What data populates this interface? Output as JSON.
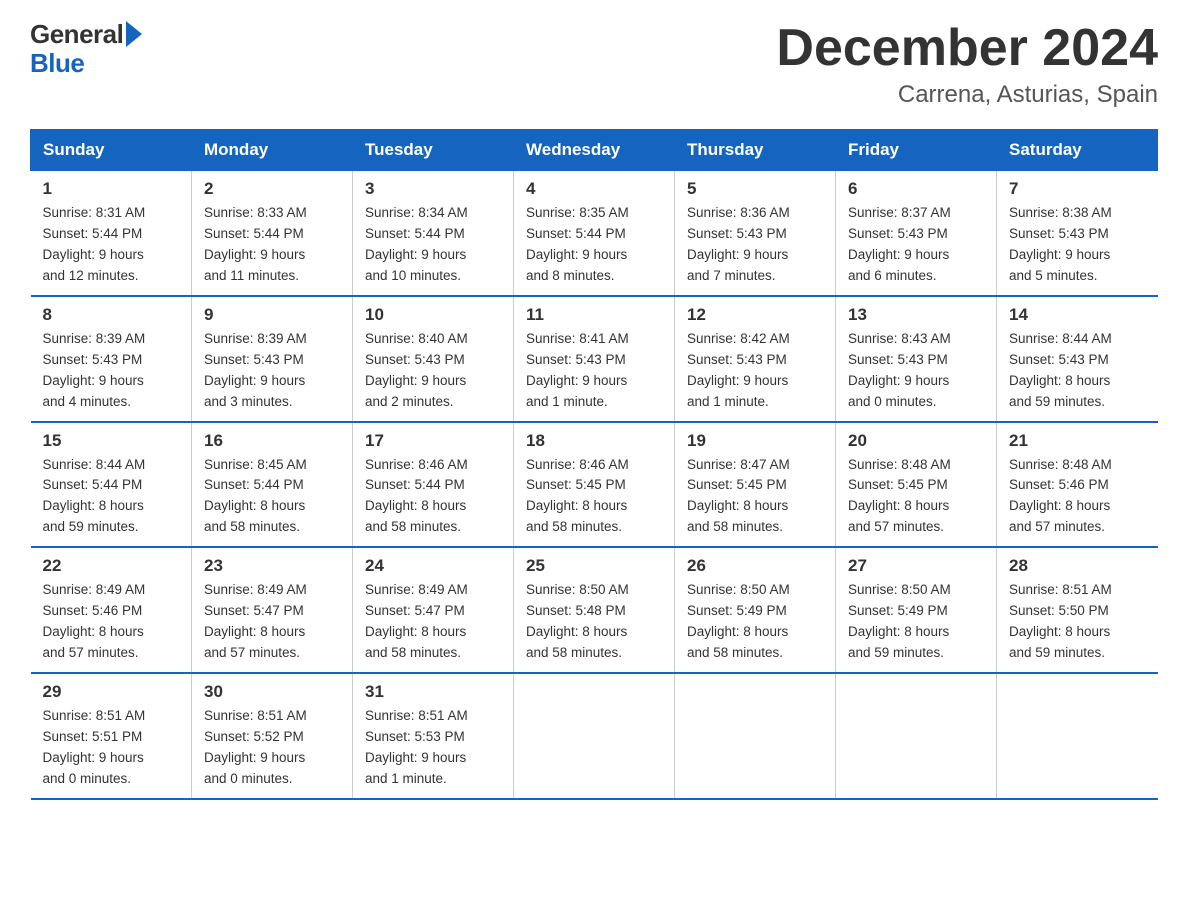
{
  "logo": {
    "line1": "General",
    "line2": "Blue"
  },
  "title": "December 2024",
  "subtitle": "Carrena, Asturias, Spain",
  "days_of_week": [
    "Sunday",
    "Monday",
    "Tuesday",
    "Wednesday",
    "Thursday",
    "Friday",
    "Saturday"
  ],
  "weeks": [
    [
      {
        "day": "1",
        "info": "Sunrise: 8:31 AM\nSunset: 5:44 PM\nDaylight: 9 hours\nand 12 minutes."
      },
      {
        "day": "2",
        "info": "Sunrise: 8:33 AM\nSunset: 5:44 PM\nDaylight: 9 hours\nand 11 minutes."
      },
      {
        "day": "3",
        "info": "Sunrise: 8:34 AM\nSunset: 5:44 PM\nDaylight: 9 hours\nand 10 minutes."
      },
      {
        "day": "4",
        "info": "Sunrise: 8:35 AM\nSunset: 5:44 PM\nDaylight: 9 hours\nand 8 minutes."
      },
      {
        "day": "5",
        "info": "Sunrise: 8:36 AM\nSunset: 5:43 PM\nDaylight: 9 hours\nand 7 minutes."
      },
      {
        "day": "6",
        "info": "Sunrise: 8:37 AM\nSunset: 5:43 PM\nDaylight: 9 hours\nand 6 minutes."
      },
      {
        "day": "7",
        "info": "Sunrise: 8:38 AM\nSunset: 5:43 PM\nDaylight: 9 hours\nand 5 minutes."
      }
    ],
    [
      {
        "day": "8",
        "info": "Sunrise: 8:39 AM\nSunset: 5:43 PM\nDaylight: 9 hours\nand 4 minutes."
      },
      {
        "day": "9",
        "info": "Sunrise: 8:39 AM\nSunset: 5:43 PM\nDaylight: 9 hours\nand 3 minutes."
      },
      {
        "day": "10",
        "info": "Sunrise: 8:40 AM\nSunset: 5:43 PM\nDaylight: 9 hours\nand 2 minutes."
      },
      {
        "day": "11",
        "info": "Sunrise: 8:41 AM\nSunset: 5:43 PM\nDaylight: 9 hours\nand 1 minute."
      },
      {
        "day": "12",
        "info": "Sunrise: 8:42 AM\nSunset: 5:43 PM\nDaylight: 9 hours\nand 1 minute."
      },
      {
        "day": "13",
        "info": "Sunrise: 8:43 AM\nSunset: 5:43 PM\nDaylight: 9 hours\nand 0 minutes."
      },
      {
        "day": "14",
        "info": "Sunrise: 8:44 AM\nSunset: 5:43 PM\nDaylight: 8 hours\nand 59 minutes."
      }
    ],
    [
      {
        "day": "15",
        "info": "Sunrise: 8:44 AM\nSunset: 5:44 PM\nDaylight: 8 hours\nand 59 minutes."
      },
      {
        "day": "16",
        "info": "Sunrise: 8:45 AM\nSunset: 5:44 PM\nDaylight: 8 hours\nand 58 minutes."
      },
      {
        "day": "17",
        "info": "Sunrise: 8:46 AM\nSunset: 5:44 PM\nDaylight: 8 hours\nand 58 minutes."
      },
      {
        "day": "18",
        "info": "Sunrise: 8:46 AM\nSunset: 5:45 PM\nDaylight: 8 hours\nand 58 minutes."
      },
      {
        "day": "19",
        "info": "Sunrise: 8:47 AM\nSunset: 5:45 PM\nDaylight: 8 hours\nand 58 minutes."
      },
      {
        "day": "20",
        "info": "Sunrise: 8:48 AM\nSunset: 5:45 PM\nDaylight: 8 hours\nand 57 minutes."
      },
      {
        "day": "21",
        "info": "Sunrise: 8:48 AM\nSunset: 5:46 PM\nDaylight: 8 hours\nand 57 minutes."
      }
    ],
    [
      {
        "day": "22",
        "info": "Sunrise: 8:49 AM\nSunset: 5:46 PM\nDaylight: 8 hours\nand 57 minutes."
      },
      {
        "day": "23",
        "info": "Sunrise: 8:49 AM\nSunset: 5:47 PM\nDaylight: 8 hours\nand 57 minutes."
      },
      {
        "day": "24",
        "info": "Sunrise: 8:49 AM\nSunset: 5:47 PM\nDaylight: 8 hours\nand 58 minutes."
      },
      {
        "day": "25",
        "info": "Sunrise: 8:50 AM\nSunset: 5:48 PM\nDaylight: 8 hours\nand 58 minutes."
      },
      {
        "day": "26",
        "info": "Sunrise: 8:50 AM\nSunset: 5:49 PM\nDaylight: 8 hours\nand 58 minutes."
      },
      {
        "day": "27",
        "info": "Sunrise: 8:50 AM\nSunset: 5:49 PM\nDaylight: 8 hours\nand 59 minutes."
      },
      {
        "day": "28",
        "info": "Sunrise: 8:51 AM\nSunset: 5:50 PM\nDaylight: 8 hours\nand 59 minutes."
      }
    ],
    [
      {
        "day": "29",
        "info": "Sunrise: 8:51 AM\nSunset: 5:51 PM\nDaylight: 9 hours\nand 0 minutes."
      },
      {
        "day": "30",
        "info": "Sunrise: 8:51 AM\nSunset: 5:52 PM\nDaylight: 9 hours\nand 0 minutes."
      },
      {
        "day": "31",
        "info": "Sunrise: 8:51 AM\nSunset: 5:53 PM\nDaylight: 9 hours\nand 1 minute."
      },
      {
        "day": "",
        "info": ""
      },
      {
        "day": "",
        "info": ""
      },
      {
        "day": "",
        "info": ""
      },
      {
        "day": "",
        "info": ""
      }
    ]
  ]
}
